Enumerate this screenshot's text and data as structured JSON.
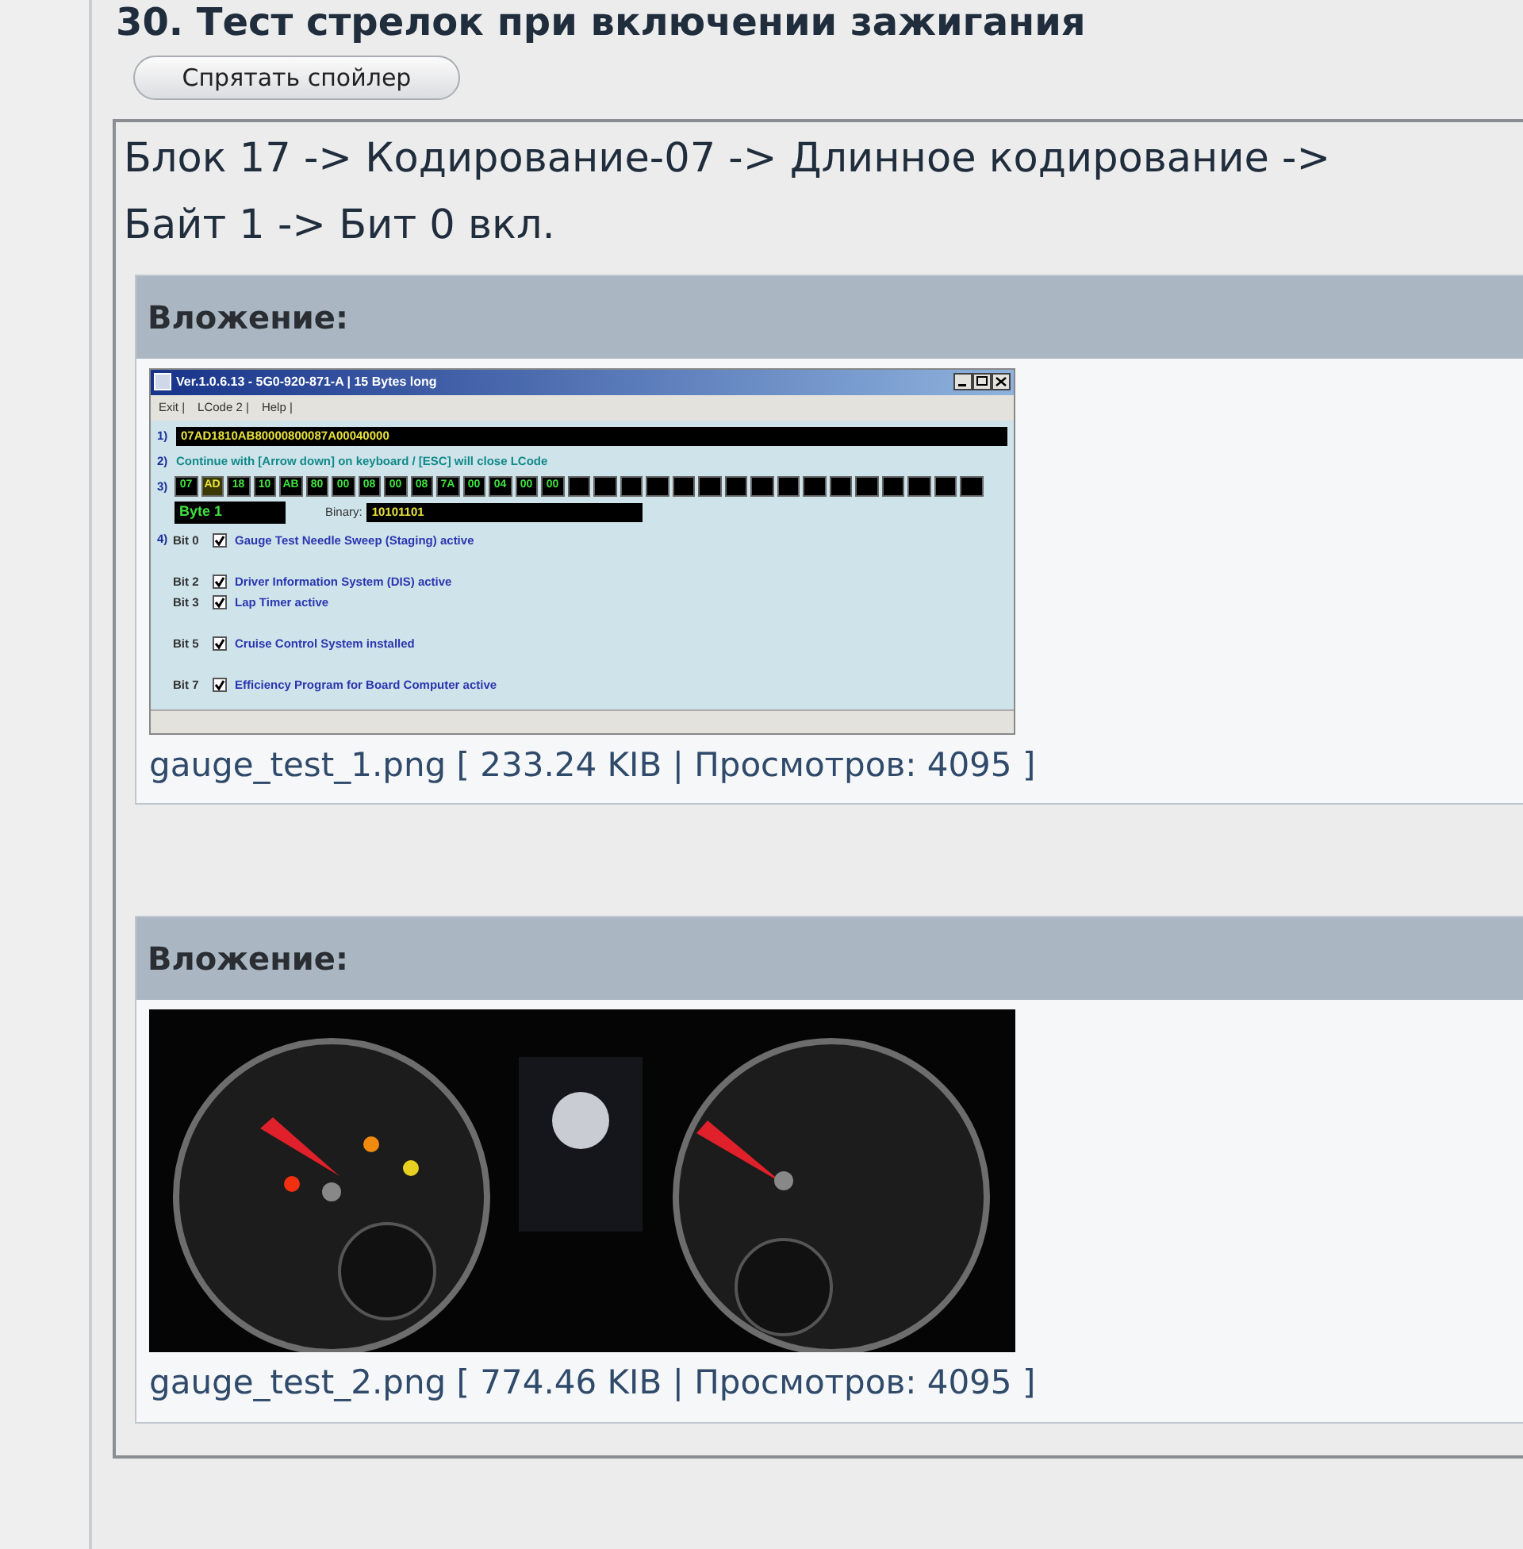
{
  "heading": "30. Тест стрелок при включении зажигания",
  "spoiler_button": "Спрятать спойлер",
  "spoiler": {
    "text_lines": [
      "Блок 17 -> Кодирование-07 -> Длинное кодирование ->",
      "Байт 1 -> Бит 0 вкл."
    ],
    "attachments": [
      {
        "kind": "screenshot",
        "header": "Вложение:",
        "caption": "gauge_test_1.png [ 233.24 KIB | Просмотров: 4095 ]",
        "app": {
          "title": "Ver.1.0.6.13 -  5G0-920-871-A | 15 Bytes long",
          "menu": [
            "Exit |",
            "LCode 2 |",
            "Help |"
          ],
          "step_1": "1)",
          "coding": "07AD1810AB80000800087A00040000",
          "step_2": "2)",
          "hint": "Continue with [Arrow down] on keyboard / [ESC] will close LCode",
          "step_3": "3)",
          "bytes": [
            {
              "value": "07",
              "selected": false
            },
            {
              "value": "AD",
              "selected": true
            },
            {
              "value": "18",
              "selected": false
            },
            {
              "value": "10",
              "selected": false
            },
            {
              "value": "AB",
              "selected": false
            },
            {
              "value": "80",
              "selected": false
            },
            {
              "value": "00",
              "selected": false
            },
            {
              "value": "08",
              "selected": false
            },
            {
              "value": "00",
              "selected": false
            },
            {
              "value": "08",
              "selected": false
            },
            {
              "value": "7A",
              "selected": false
            },
            {
              "value": "00",
              "selected": false
            },
            {
              "value": "04",
              "selected": false
            },
            {
              "value": "00",
              "selected": false
            },
            {
              "value": "00",
              "selected": false
            }
          ],
          "byte_label": "Byte 1",
          "binary_label": "Binary:",
          "binary": "10101101",
          "step_4": "4)",
          "bits": [
            {
              "kind": "bit",
              "label": "Bit 0",
              "checked": true,
              "text": "Gauge Test Needle Sweep (Staging) active"
            },
            {
              "kind": "blank"
            },
            {
              "kind": "bit",
              "label": "Bit 2",
              "checked": true,
              "text": "Driver Information System (DIS) active"
            },
            {
              "kind": "bit",
              "label": "Bit 3",
              "checked": true,
              "text": "Lap Timer active"
            },
            {
              "kind": "blank"
            },
            {
              "kind": "bit",
              "label": "Bit 5",
              "checked": true,
              "text": "Cruise Control System installed"
            },
            {
              "kind": "blank"
            },
            {
              "kind": "bit",
              "label": "Bit 7",
              "checked": true,
              "text": "Efficiency Program for Board Computer active"
            }
          ]
        }
      },
      {
        "kind": "picture",
        "header": "Вложение:",
        "caption": "gauge_test_2.png [ 774.46 KIB | Просмотров: 4095 ]"
      }
    ]
  }
}
